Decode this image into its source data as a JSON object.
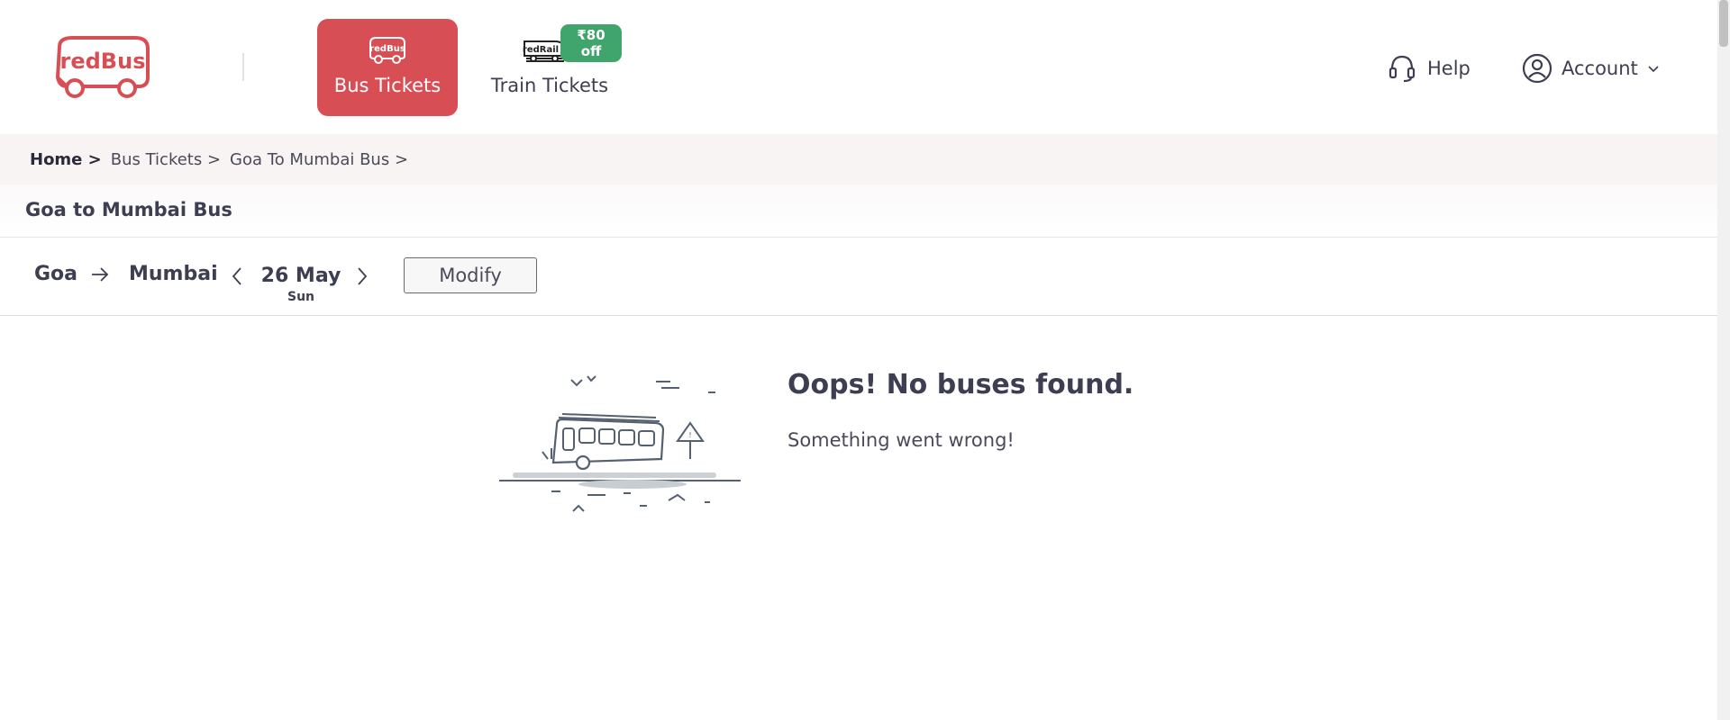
{
  "header": {
    "logo_text": "redBus",
    "nav": {
      "bus_label": "Bus Tickets",
      "bus_icon_text": "redBus",
      "train_label": "Train Tickets",
      "train_icon_text": "redRail",
      "train_offer": "₹80 off"
    },
    "help_label": "Help",
    "account_label": "Account"
  },
  "breadcrumb": {
    "items": [
      "Home >",
      "Bus Tickets >",
      "Goa To Mumbai Bus >"
    ]
  },
  "page_title": "Goa to Mumbai Bus",
  "search": {
    "from": "Goa",
    "to": "Mumbai",
    "date": "26 May",
    "day": "Sun",
    "modify_label": "Modify"
  },
  "empty_state": {
    "title": "Oops! No buses found.",
    "subtitle": "Something went wrong!"
  },
  "icons": {
    "help": "headset-icon",
    "account": "user-circle-icon",
    "dropdown": "chevron-down-icon",
    "route_arrow": "arrow-right-icon",
    "prev_date": "chevron-left-icon",
    "next_date": "chevron-right-icon",
    "illustration": "bus-breakdown-illustration"
  },
  "colors": {
    "brand": "#d84e55",
    "offer": "#40a56c",
    "text": "#3e3e52",
    "breadcrumb_bg": "#f8f4f4"
  }
}
